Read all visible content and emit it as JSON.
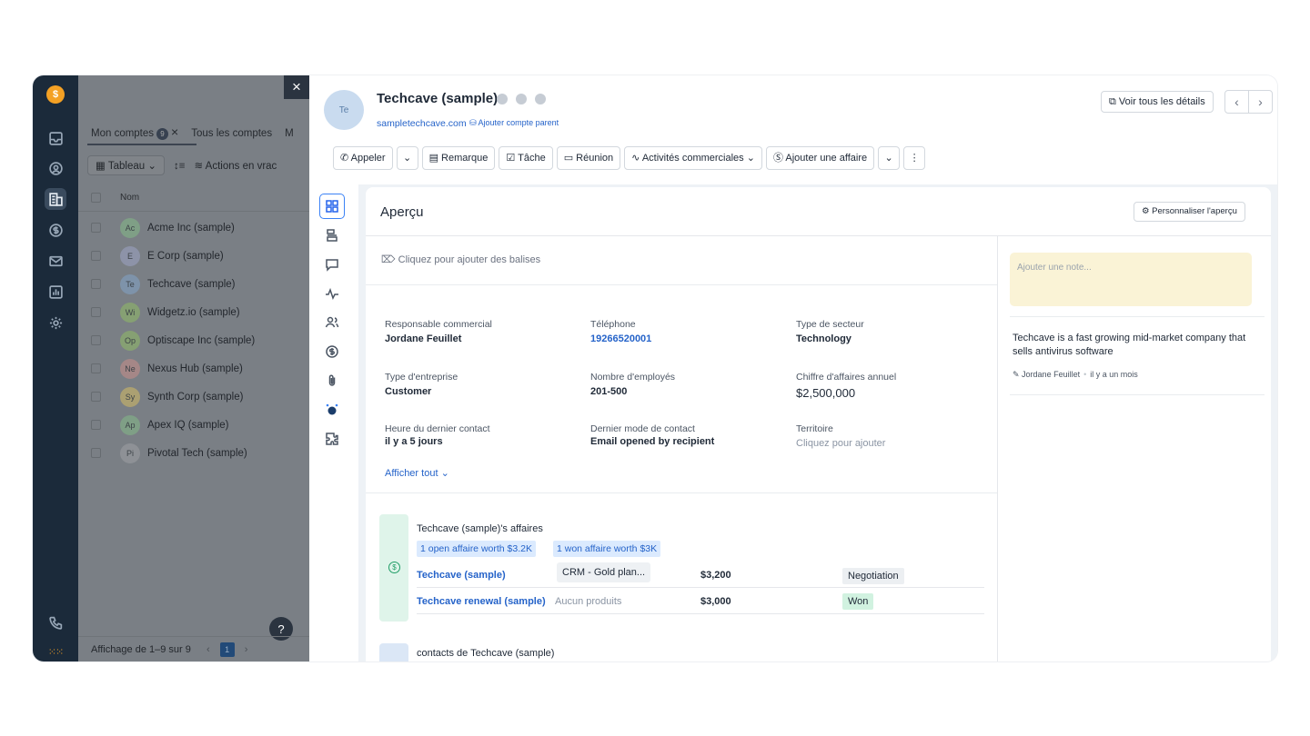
{
  "list": {
    "close_label": "×",
    "tab_mine": "Mon comptes",
    "tab_mine_count": "9",
    "tab_mine_close": "×",
    "tab_all": "Tous les comptes",
    "tab_more": "M",
    "view_label": "Tableau",
    "bulk_label": "Actions en vrac",
    "col_name": "Nom",
    "rows": [
      {
        "initials": "Ac",
        "name": "Acme Inc (sample)",
        "color": "#7f9f86"
      },
      {
        "initials": "E",
        "name": "E Corp (sample)",
        "color": "#8d93a8"
      },
      {
        "initials": "Te",
        "name": "Techcave (sample)",
        "color": "#7e93aa"
      },
      {
        "initials": "Wi",
        "name": "Widgetz.io (sample)",
        "color": "#86a073"
      },
      {
        "initials": "Op",
        "name": "Optiscape Inc (sample)",
        "color": "#86a073"
      },
      {
        "initials": "Ne",
        "name": "Nexus Hub (sample)",
        "color": "#a58787"
      },
      {
        "initials": "Sy",
        "name": "Synth Corp (sample)",
        "color": "#aba072"
      },
      {
        "initials": "Ap",
        "name": "Apex IQ (sample)",
        "color": "#7f9f86"
      },
      {
        "initials": "Pi",
        "name": "Pivotal Tech (sample)",
        "color": "#8e9196"
      }
    ],
    "pager_text": "Affichage de 1–9 sur 9",
    "pager_page": "1",
    "help": "?"
  },
  "record": {
    "initials": "Te",
    "title": "Techcave (sample)",
    "domain": "sampletechcave.com",
    "add_parent": "Ajouter compte parent",
    "view_all": "Voir tous les détails",
    "prev": "‹",
    "next": "›"
  },
  "actions": {
    "call": "Appeler",
    "note": "Remarque",
    "task": "Tâche",
    "meeting": "Réunion",
    "sales": "Activités commerciales",
    "add_deal": "Ajouter une affaire",
    "more": "⋮"
  },
  "overview": {
    "title": "Aperçu",
    "customize": "Personnaliser l'aperçu",
    "tags_hint": "Cliquez pour ajouter des balises",
    "fields": {
      "owner_label": "Responsable commercial",
      "owner": "Jordane Feuillet",
      "phone_label": "Téléphone",
      "phone": "19266520001",
      "industry_label": "Type de secteur",
      "industry": "Technology",
      "type_label": "Type d'entreprise",
      "type": "Customer",
      "employees_label": "Nombre d'employés",
      "employees": "201-500",
      "revenue_label": "Chiffre d'affaires annuel",
      "revenue": "$2,500,000",
      "last_contact_label": "Heure du dernier contact",
      "last_contact": "il y a 5 jours",
      "last_mode_label": "Dernier mode de contact",
      "last_mode": "Email opened by recipient",
      "territory_label": "Territoire",
      "territory": "Cliquez pour ajouter"
    },
    "show_all": "Afficher tout"
  },
  "deals": {
    "title": "Techcave (sample)'s affaires",
    "badge_open": "1 open affaire worth $3.2K",
    "badge_won": "1 won affaire worth $3K",
    "rows": [
      {
        "name": "Techcave (sample)",
        "product": "CRM - Gold plan...",
        "amount": "$3,200",
        "stage": "Negotiation"
      },
      {
        "name": "Techcave renewal (sample)",
        "product": "Aucun produits",
        "amount": "$3,000",
        "stage": "Won"
      }
    ]
  },
  "contacts": {
    "title": "contacts de Techcave (sample)"
  },
  "notes": {
    "placeholder": "Ajouter une note...",
    "text": "Techcave is a fast growing mid-market company that sells antivirus software",
    "author": "Jordane Feuillet",
    "time": "il y a un mois"
  },
  "colors": {
    "rail": "#1b2a3a",
    "brand": "#f4a124",
    "link": "#2563c9",
    "won": "#d1f2e0",
    "negotiation": "#eceff2"
  }
}
